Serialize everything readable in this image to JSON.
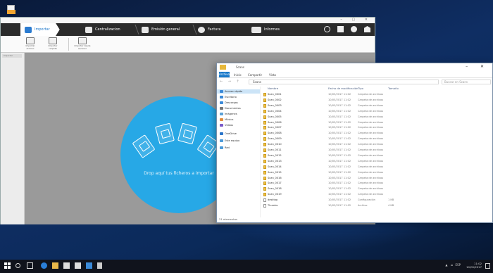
{
  "app": {
    "title": "",
    "nav_tabs": [
      {
        "label": "Importar"
      },
      {
        "label": "Centralizacion"
      },
      {
        "label": "Emisión general"
      },
      {
        "label": "Factura"
      },
      {
        "label": "Informes"
      }
    ],
    "toolbar": [
      {
        "label": "Importar archivo"
      },
      {
        "label": "Importar carpeta"
      },
      {
        "label": "Importar desde escaner"
      }
    ],
    "left_tag": "Importar",
    "drop_text": "Drop aquí tus ficheros a importar",
    "accent": "#27a8e6"
  },
  "explorer": {
    "title": "Scans",
    "ribbon_file": "Archivo",
    "ribbon_tabs": [
      "Inicio",
      "Compartir",
      "Vista"
    ],
    "address": "Scans",
    "search_placeholder": "Buscar en Scans",
    "nav_items": [
      {
        "label": "Acceso rápido",
        "selected": true,
        "color": "#3b8ad8"
      },
      {
        "label": "Escritorio",
        "color": "#3b8ad8"
      },
      {
        "label": "Descargas",
        "color": "#3b8ad8"
      },
      {
        "label": "Documentos",
        "color": "#777777"
      },
      {
        "label": "Imágenes",
        "color": "#5aa0d6"
      },
      {
        "label": "Música",
        "color": "#e28b3b"
      },
      {
        "label": "Vídeos",
        "color": "#7a59c9"
      },
      {
        "label": "OneDrive",
        "color": "#2a74c9"
      },
      {
        "label": "Este equipo",
        "color": "#4d9ad8"
      },
      {
        "label": "Red",
        "color": "#4d9ad8"
      }
    ],
    "columns": {
      "name": "Nombre",
      "date": "Fecha de modificación",
      "type": "Tipo",
      "size": "Tamaño"
    },
    "rows": [
      {
        "name": "Scan_0001",
        "date": "10/05/2017 11:02",
        "type": "Carpeta de archivos",
        "size": "",
        "kind": "folder"
      },
      {
        "name": "Scan_0002",
        "date": "10/05/2017 11:02",
        "type": "Carpeta de archivos",
        "size": "",
        "kind": "folder"
      },
      {
        "name": "Scan_0003",
        "date": "10/05/2017 11:02",
        "type": "Carpeta de archivos",
        "size": "",
        "kind": "folder"
      },
      {
        "name": "Scan_0004",
        "date": "10/05/2017 11:02",
        "type": "Carpeta de archivos",
        "size": "",
        "kind": "folder"
      },
      {
        "name": "Scan_0005",
        "date": "10/05/2017 11:02",
        "type": "Carpeta de archivos",
        "size": "",
        "kind": "folder"
      },
      {
        "name": "Scan_0006",
        "date": "10/05/2017 11:02",
        "type": "Carpeta de archivos",
        "size": "",
        "kind": "folder"
      },
      {
        "name": "Scan_0007",
        "date": "10/05/2017 11:02",
        "type": "Carpeta de archivos",
        "size": "",
        "kind": "folder"
      },
      {
        "name": "Scan_0008",
        "date": "10/05/2017 11:02",
        "type": "Carpeta de archivos",
        "size": "",
        "kind": "folder"
      },
      {
        "name": "Scan_0009",
        "date": "10/05/2017 11:02",
        "type": "Carpeta de archivos",
        "size": "",
        "kind": "folder"
      },
      {
        "name": "Scan_0010",
        "date": "10/05/2017 11:02",
        "type": "Carpeta de archivos",
        "size": "",
        "kind": "folder"
      },
      {
        "name": "Scan_0011",
        "date": "10/05/2017 11:02",
        "type": "Carpeta de archivos",
        "size": "",
        "kind": "folder"
      },
      {
        "name": "Scan_0012",
        "date": "10/05/2017 11:02",
        "type": "Carpeta de archivos",
        "size": "",
        "kind": "folder"
      },
      {
        "name": "Scan_0013",
        "date": "10/05/2017 11:02",
        "type": "Carpeta de archivos",
        "size": "",
        "kind": "folder"
      },
      {
        "name": "Scan_0014",
        "date": "10/05/2017 11:02",
        "type": "Carpeta de archivos",
        "size": "",
        "kind": "folder"
      },
      {
        "name": "Scan_0015",
        "date": "10/05/2017 11:02",
        "type": "Carpeta de archivos",
        "size": "",
        "kind": "folder"
      },
      {
        "name": "Scan_0016",
        "date": "10/05/2017 11:02",
        "type": "Carpeta de archivos",
        "size": "",
        "kind": "folder"
      },
      {
        "name": "Scan_0017",
        "date": "10/05/2017 11:02",
        "type": "Carpeta de archivos",
        "size": "",
        "kind": "folder"
      },
      {
        "name": "Scan_0018",
        "date": "10/05/2017 11:02",
        "type": "Carpeta de archivos",
        "size": "",
        "kind": "folder"
      },
      {
        "name": "Scan_0019",
        "date": "10/05/2017 11:02",
        "type": "Carpeta de archivos",
        "size": "",
        "kind": "folder"
      },
      {
        "name": "desktop",
        "date": "10/05/2017 11:02",
        "type": "Configuración",
        "size": "1 KB",
        "kind": "doc"
      },
      {
        "name": "Thumbs",
        "date": "10/05/2017 11:02",
        "type": "Archivo",
        "size": "4 KB",
        "kind": "doc"
      }
    ],
    "status": "21 elementos"
  },
  "taskbar": {
    "tray_text": "ESP",
    "time": "11:02",
    "date": "10/05/2017"
  }
}
